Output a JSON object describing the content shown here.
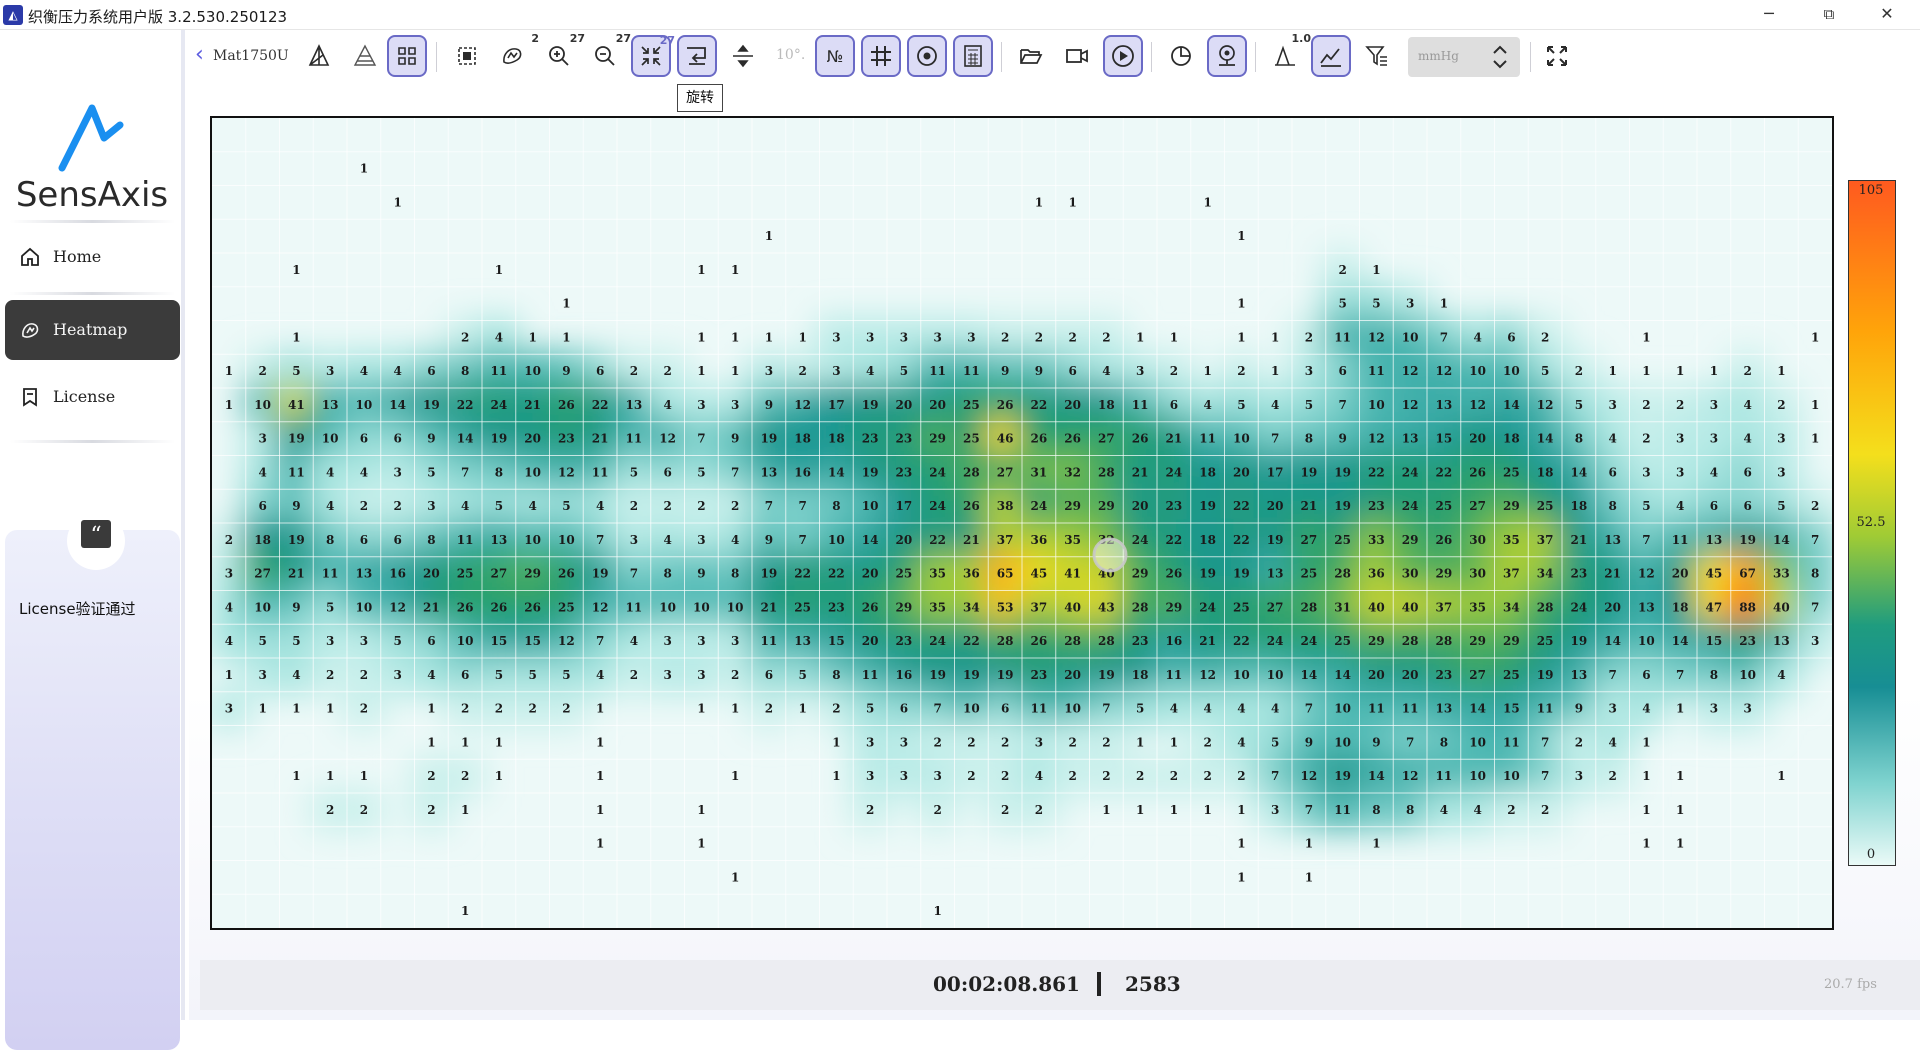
{
  "window": {
    "title": "织衡压力系统用户版 3.2.530.250123",
    "minimize": "─",
    "maximize": "⧉",
    "close": "✕"
  },
  "sidebar": {
    "logo_text": "SensAxis",
    "nav": [
      {
        "label": "Home",
        "icon": "home-icon"
      },
      {
        "label": "Heatmap",
        "icon": "heatmap-icon",
        "active": true
      },
      {
        "label": "License",
        "icon": "license-icon"
      }
    ],
    "license_status": "License验证通过"
  },
  "toolbar": {
    "back": "‹",
    "device_name": "Mat1750U",
    "badge_pressure": "2",
    "badge_zoom_in": "27",
    "badge_zoom_out": "27",
    "badge_fit": "27",
    "angle_value": "10°.",
    "peak_value": "1.0",
    "unit_label": "mmHg",
    "tooltip": "旋转"
  },
  "scale": {
    "max": "105",
    "mid": "52.5",
    "min": "0"
  },
  "status": {
    "timer": "00:02:08.861",
    "frames": "2583",
    "fps": "20.7 fps"
  },
  "colors": {
    "accent": "#5a5ae0",
    "active_bg": "#dcdcf6",
    "active_border": "#6a6ac6",
    "nav_active": "#3b3b3b"
  },
  "heatmap": {
    "cols": 48,
    "rows": 24,
    "grid": [
      "",
      "4:1",
      "5:1 24:1 25:1 29:1",
      "16:1 30:1",
      "2:1 8:1 14:1 15:1 33:2 34:1",
      "10:1 30:1 33:5 34:5 35:3 36:1",
      "2:1 7:2 8:4 9:1 10:1 14:1 15:1 16:1 17:1 18:3 19:3 20:3 21:3 22:3 23:2 24:2 25:2 26:2 27:1 28:1 30:1 31:1 32:2 33:11 34:12 35:10 36:7 37:4 38:6 39:2 42:1 47:1",
      "0:1 1:2 2:5 3:3 4:4 5:4 6:6 7:8 8:11 9:10 10:9 11:6 12:2 13:2 14:1 15:1 16:3 17:2 18:3 19:4 20:5 21:11 22:11 23:9 24:9 25:6 26:4 27:3 28:2 29:1 30:2 31:1 32:3 33:6 34:11 35:12 36:12 37:10 38:10 39:5 40:2 41:1 42:1 43:1 44:1 45:2 46:1",
      "0:1 1:10 2:41 3:13 4:10 5:14 6:19 7:22 8:24 9:21 10:26 11:22 12:13 13:4 14:3 15:3 16:9 17:12 18:17 19:19 20:20 21:20 22:25 23:26 24:22 25:20 26:18 27:11 28:6 29:4 30:5 31:4 32:5 33:7 34:10 35:12 36:13 37:12 38:14 39:12 40:5 41:3 42:2 43:2 44:3 45:4 46:2 47:1",
      "1:3 2:19 3:10 4:6 5:6 6:9 7:14 8:19 9:20 10:23 11:21 12:11 13:12 14:7 15:9 16:19 17:18 18:18 19:23 20:23 21:29 22:25 23:46 24:26 25:26 26:27 27:26 28:21 29:11 30:10 31:7 32:8 33:9 34:12 35:13 36:15 37:20 38:18 39:14 40:8 41:4 42:2 43:3 44:3 45:4 46:3 47:1",
      "1:4 2:11 3:4 4:4 5:3 6:5 7:7 8:8 9:10 10:12 11:11 12:5 13:6 14:5 15:7 16:13 17:16 18:14 19:19 20:23 21:24 22:28 23:27 24:31 25:32 26:28 27:21 28:24 29:18 30:20 31:17 32:19 33:19 34:22 35:24 36:22 37:26 38:25 39:18 40:14 41:6 42:3 43:3 44:4 45:6 46:3",
      "1:6 2:9 3:4 4:2 5:2 6:3 7:4 8:5 9:4 10:5 11:4 12:2 13:2 14:2 15:2 16:7 17:7 18:8 19:10 20:17 21:24 22:26 23:38 24:24 25:29 26:29 27:20 28:23 29:19 30:22 31:20 32:21 33:19 34:23 35:24 36:25 37:27 38:29 39:25 40:18 41:8 42:5 43:4 44:6 45:6 46:5 47:2",
      "0:2 1:18 2:19 3:8 4:6 5:6 6:8 7:11 8:13 9:10 10:10 11:7 12:3 13:4 14:3 15:4 16:9 17:7 18:10 19:14 20:20 21:22 22:21 23:37 24:36 25:35 26:32 27:24 28:22 29:18 30:22 31:19 32:27 33:25 34:33 35:29 36:26 37:30 38:35 39:37 40:21 41:13 42:7 43:11 44:13 45:19 46:14 47:7",
      "0:3 1:27 2:21 3:11 4:13 5:16 6:20 7:25 8:27 9:29 10:26 11:19 12:7 13:8 14:9 15:8 16:19 17:22 18:22 19:20 20:25 21:35 22:36 23:65 24:45 25:41 26:40 27:29 28:26 29:19 30:19 31:13 32:25 33:28 34:36 35:30 36:29 37:30 38:37 39:34 40:23 41:21 42:12 43:20 44:45 45:67 46:33 47:8",
      "0:4 1:10 2:9 3:5 4:10 5:12 6:21 7:26 8:26 9:26 10:25 11:12 12:11 13:10 14:10 15:10 16:21 17:25 18:23 19:26 20:29 21:35 22:34 23:53 24:37 25:40 26:43 27:28 28:29 29:24 30:25 31:27 32:28 33:31 34:40 35:40 36:37 37:35 38:34 39:28 40:24 41:20 42:13 43:18 44:47 45:88 46:40 47:7",
      "0:4 1:5 2:5 3:3 4:3 5:5 6:6 7:10 8:15 9:15 10:12 11:7 12:4 13:3 14:3 15:3 16:11 17:13 18:15 19:20 20:23 21:24 22:22 23:28 24:26 25:28 26:28 27:23 28:16 29:21 30:22 31:24 32:24 33:25 34:29 35:28 36:28 37:29 38:29 39:25 40:19 41:14 42:10 43:14 44:15 45:23 46:13 47:3",
      "0:1 1:3 2:4 3:2 4:2 5:3 6:4 7:6 8:5 9:5 10:5 11:4 12:2 13:3 14:3 15:2 16:6 17:5 18:8 19:11 20:16 21:19 22:19 23:19 24:23 25:20 26:19 27:18 28:11 29:12 30:10 31:10 32:14 33:14 34:20 35:20 36:23 37:27 38:25 39:19 40:13 41:7 42:6 43:7 44:8 45:10 46:4",
      "0:3 1:1 2:1 3:1 4:2 6:1 7:2 8:2 9:2 10:2 11:1 14:1 15:1 16:2 17:1 18:2 19:5 20:6 21:7 22:10 23:6 24:11 25:10 26:7 27:5 28:4 29:4 30:4 31:4 32:7 33:10 34:11 35:11 36:13 37:14 38:15 39:11 40:9 41:3 42:4 43:1 44:3 45:3",
      "6:1 7:1 8:1 11:1 18:1 19:3 20:3 21:2 22:2 23:2 24:3 25:2 26:2 27:1 28:1 29:2 30:4 31:5 32:9 33:10 34:9 35:7 36:8 37:10 38:11 39:7 40:2 41:4 42:1",
      "2:1 3:1 4:1 6:2 7:2 8:1 11:1 15:1 18:1 19:3 20:3 21:3 22:2 23:2 24:4 25:2 26:2 27:2 28:2 29:2 30:2 31:7 32:12 33:19 34:14 35:12 36:11 37:10 38:10 39:7 40:3 41:2 42:1 43:1 46:1",
      "3:2 4:2 6:2 7:1 11:1 14:1 19:2 21:2 23:2 24:2 26:1 27:1 28:1 29:1 30:1 31:3 32:7 33:11 34:8 35:8 36:4 37:4 38:2 39:2 42:1 43:1",
      "11:1 14:1 30:1 32:1 34:1 42:1 43:1",
      "15:1 30:1 32:1",
      "7:1 21:1"
    ]
  }
}
